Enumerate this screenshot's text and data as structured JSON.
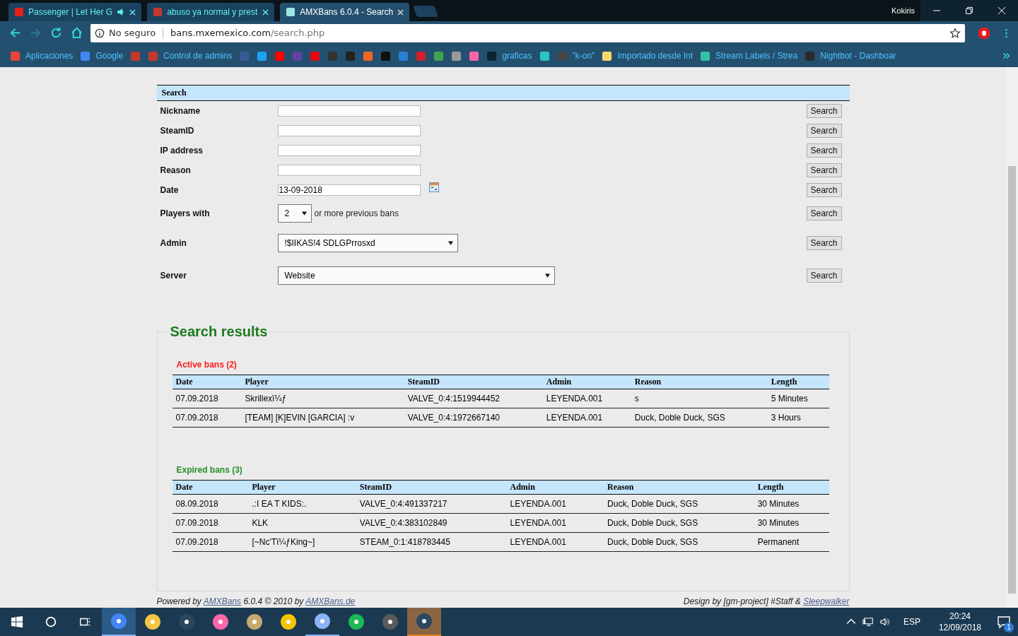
{
  "window": {
    "profile": "Kokiris"
  },
  "tabs": [
    {
      "title": "Passenger | Let Her G",
      "color": "#e62117",
      "audio": true,
      "selected": false
    },
    {
      "title": "abuso ya normal y prest",
      "color": "#c0392b",
      "audio": false,
      "selected": false
    },
    {
      "title": "AMXBans 6.0.4 - Search",
      "color": "#9ee6e6",
      "audio": false,
      "selected": true
    }
  ],
  "address_bar": {
    "security": "No seguro",
    "host": "bans.mxemexico.com",
    "path": "/search.php"
  },
  "bookmarks": [
    {
      "label": "Aplicaciones",
      "color": "#e8453c"
    },
    {
      "label": "Google",
      "color": "#4285f4"
    },
    {
      "color": "#c0392b"
    },
    {
      "label": "Control de admins",
      "color": "#c0392b"
    },
    {
      "color": "#3b5998"
    },
    {
      "color": "#1da1f2"
    },
    {
      "color": "#ff0000"
    },
    {
      "color": "#6441a5"
    },
    {
      "color": "#e50914"
    },
    {
      "color": "#333333"
    },
    {
      "color": "#222222"
    },
    {
      "color": "#f26522"
    },
    {
      "color": "#111111"
    },
    {
      "color": "#2a7fd4"
    },
    {
      "color": "#d0202e"
    },
    {
      "color": "#3fa34d"
    },
    {
      "color": "#999999"
    },
    {
      "color": "#ff66aa"
    },
    {
      "label": "graficas",
      "color": "#0d2233"
    },
    {
      "color": "#2ec4c4"
    },
    {
      "label": "\"k-on\"",
      "color": "#444444"
    },
    {
      "label": "Importado desde Int",
      "color": "#f5d76e"
    },
    {
      "label": "Stream Labels / Strea",
      "color": "#31c3a2"
    },
    {
      "label": "Nightbot - Dashboar",
      "color": "#2b2b2b"
    }
  ],
  "search_form": {
    "title": "Search",
    "fields": [
      {
        "kind": "text",
        "label": "Nickname",
        "button": "Search"
      },
      {
        "kind": "text",
        "label": "SteamID",
        "button": "Search"
      },
      {
        "kind": "text",
        "label": "IP address",
        "button": "Search"
      },
      {
        "kind": "text",
        "label": "Reason",
        "button": "Search"
      },
      {
        "kind": "date",
        "label": "Date",
        "value": "13-09-2018",
        "button": "Search"
      },
      {
        "kind": "count",
        "label": "Players with",
        "value": "2",
        "suffix": "or more previous bans",
        "button": "Search"
      },
      {
        "kind": "select",
        "label": "Admin",
        "value": "!$IIKAS!4 SDLGPrrosxd",
        "button": "Search"
      },
      {
        "kind": "wide-select",
        "label": "Server",
        "value": "Website",
        "button": "Search"
      }
    ]
  },
  "results": {
    "title": "Search results",
    "sections": [
      {
        "color": "#ff1a1a",
        "heading": "Active bans (2)",
        "columns": [
          "Date",
          "Player",
          "SteamID",
          "Admin",
          "Reason",
          "Length"
        ],
        "rows": [
          [
            "07.09.2018",
            "Skrillexï¼ƒ",
            "VALVE_0:4:1519944452",
            "LEYENDA.001",
            "s",
            "5 Minutes"
          ],
          [
            "07.09.2018",
            "[TEAM] [K]EVIN [GARCIA] :v",
            "VALVE_0:4:1972667140",
            "LEYENDA.001",
            "Duck, Doble Duck, SGS",
            "3 Hours"
          ]
        ]
      },
      {
        "color": "#259125",
        "heading": "Expired bans (3)",
        "columns": [
          "Date",
          "Player",
          "SteamID",
          "Admin",
          "Reason",
          "Length"
        ],
        "rows": [
          [
            "08.09.2018",
            ".:I EA T KIDS:.",
            "VALVE_0:4:491337217",
            "LEYENDA.001",
            "Duck, Doble Duck, SGS",
            "30 Minutes"
          ],
          [
            "07.09.2018",
            "KLK",
            "VALVE_0:4:383102849",
            "LEYENDA.001",
            "Duck, Doble Duck, SGS",
            "30 Minutes"
          ],
          [
            "07.09.2018",
            "[~Nc'Tï¼ƒKing~]",
            "STEAM_0:1:418783445",
            "LEYENDA.001",
            "Duck, Doble Duck, SGS",
            "Permanent"
          ]
        ]
      }
    ]
  },
  "footer": {
    "left": [
      {
        "kind": "text",
        "text": "Powered by "
      },
      {
        "kind": "link",
        "text": "AMXBans"
      },
      {
        "kind": "text",
        "text": " 6.0.4 © 2010 by "
      },
      {
        "kind": "link",
        "text": "AMXBans.de"
      }
    ],
    "right": [
      {
        "kind": "text",
        "text": "Design by [gm-project] #Staff & "
      },
      {
        "kind": "link",
        "text": "Sleepwalker"
      }
    ]
  },
  "taskbar": {
    "apps": [
      {
        "color": "#4285f4",
        "selected": true,
        "running": true,
        "flashing": false
      },
      {
        "color": "#f4c542",
        "selected": false,
        "running": false,
        "flashing": false
      },
      {
        "color": "#2a475e",
        "selected": false,
        "running": false,
        "flashing": false
      },
      {
        "color": "#ff66aa",
        "selected": false,
        "running": false,
        "flashing": false
      },
      {
        "color": "#c8aa6e",
        "selected": false,
        "running": false,
        "flashing": false
      },
      {
        "color": "#f5c400",
        "selected": false,
        "running": false,
        "flashing": false
      },
      {
        "color": "#8ab4f8",
        "selected": false,
        "running": true,
        "flashing": false
      },
      {
        "color": "#1db954",
        "selected": false,
        "running": false,
        "flashing": false
      },
      {
        "color": "#5a5a5a",
        "selected": false,
        "running": false,
        "flashing": false
      },
      {
        "color": "#2a475e",
        "selected": false,
        "running": true,
        "flashing": true
      }
    ],
    "language": "ESP",
    "time": "20:24",
    "date": "12/09/2018",
    "notifications": "1"
  }
}
